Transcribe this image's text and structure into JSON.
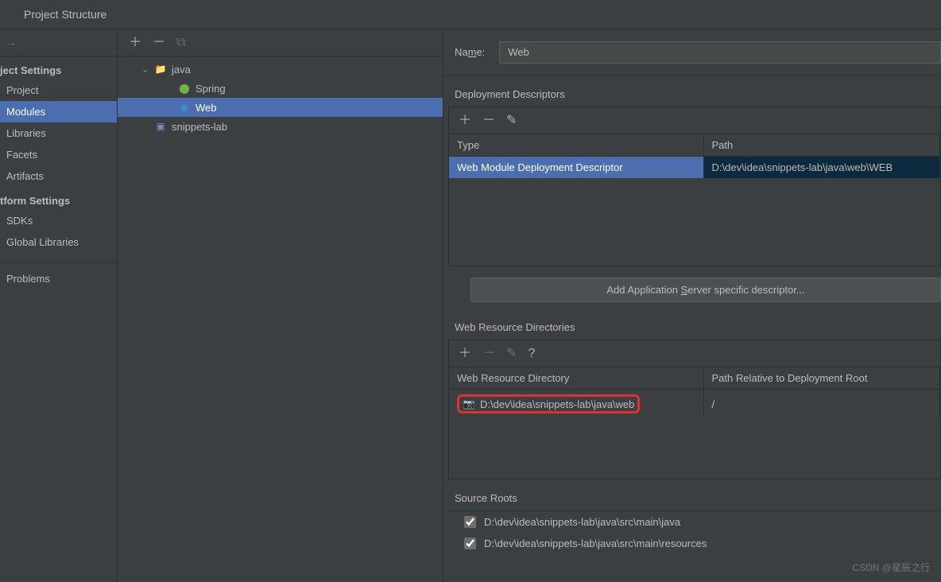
{
  "window": {
    "title": "Project Structure"
  },
  "sidebar": {
    "sections": [
      {
        "title": "ject Settings",
        "items": [
          {
            "label": "Project"
          },
          {
            "label": "Modules",
            "selected": true
          },
          {
            "label": "Libraries"
          },
          {
            "label": "Facets"
          },
          {
            "label": "Artifacts"
          }
        ]
      },
      {
        "title": "tform Settings",
        "items": [
          {
            "label": "SDKs"
          },
          {
            "label": "Global Libraries"
          }
        ]
      }
    ],
    "problems": "Problems"
  },
  "tree": {
    "root": {
      "label": "java"
    },
    "children": [
      {
        "label": "Spring",
        "icon": "spring"
      },
      {
        "label": "Web",
        "icon": "web",
        "selected": true
      }
    ],
    "sibling": {
      "label": "snippets-lab",
      "icon": "module"
    }
  },
  "details": {
    "name_label_pre": "Na",
    "name_label_u": "m",
    "name_label_post": "e:",
    "name_value": "Web",
    "deployment_descriptors": {
      "title": "Deployment Descriptors",
      "col1": "Type",
      "col2": "Path",
      "row_type": "Web Module Deployment Descriptor",
      "row_path": "D:\\dev\\idea\\snippets-lab\\java\\web\\WEB",
      "button_pre": "Add Application ",
      "button_u": "S",
      "button_post": "erver specific descriptor..."
    },
    "web_resource": {
      "title": "Web Resource Directories",
      "col1": "Web Resource Directory",
      "col2": "Path Relative to Deployment Root",
      "row_dir": "D:\\dev\\idea\\snippets-lab\\java\\web",
      "row_rel": "/"
    },
    "source_roots": {
      "title": "Source Roots",
      "items": [
        "D:\\dev\\idea\\snippets-lab\\java\\src\\main\\java",
        "D:\\dev\\idea\\snippets-lab\\java\\src\\main\\resources"
      ]
    }
  },
  "watermark": "CSDN @星辰之行"
}
